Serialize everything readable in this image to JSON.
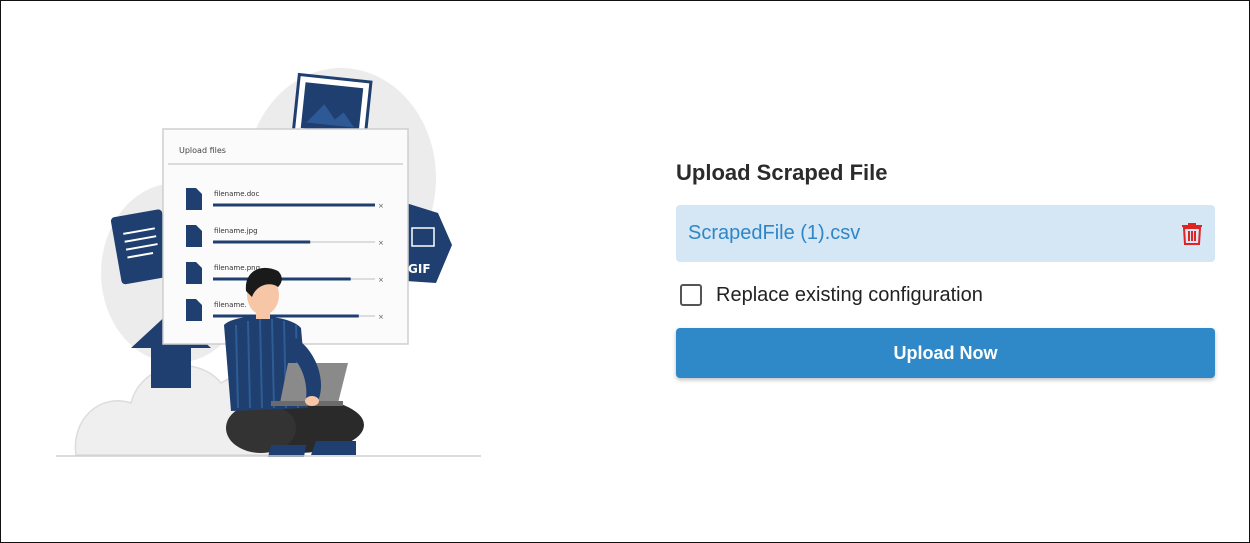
{
  "illustration": {
    "card_title": "Upload files",
    "files": [
      "filename.doc",
      "filename.jpg",
      "filename.png",
      "filename."
    ],
    "progress": [
      1.0,
      0.6,
      0.85,
      0.9
    ],
    "gif_label": "GIF",
    "colors": {
      "navy": "#1e3f6f",
      "cloud": "#efefef",
      "skin": "#f6c6a7"
    }
  },
  "upload": {
    "title": "Upload Scraped File",
    "file_name": "ScrapedFile (1).csv",
    "delete_icon": "trash-icon",
    "replace_label": "Replace existing configuration",
    "replace_checked": false,
    "button_label": "Upload Now"
  },
  "colors": {
    "accent": "#2f88c8",
    "file_bg": "#d5e6f4",
    "file_text": "#2f86c6",
    "delete": "#e02424"
  }
}
